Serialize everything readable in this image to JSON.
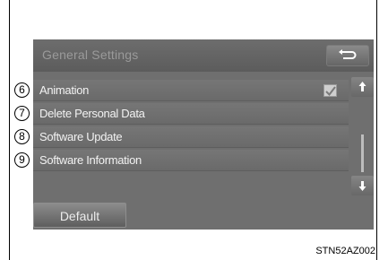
{
  "screen": {
    "title": "General Settings",
    "back_icon": "return-arrow-icon"
  },
  "items": [
    {
      "callout": "6",
      "label": "Animation",
      "checked": true
    },
    {
      "callout": "7",
      "label": "Delete Personal Data"
    },
    {
      "callout": "8",
      "label": "Software Update"
    },
    {
      "callout": "9",
      "label": "Software Information"
    }
  ],
  "scroll": {
    "up_icon": "scroll-up-icon",
    "down_icon": "scroll-down-icon"
  },
  "footer": {
    "default_label": "Default"
  },
  "figure_code": "STN52AZ002"
}
